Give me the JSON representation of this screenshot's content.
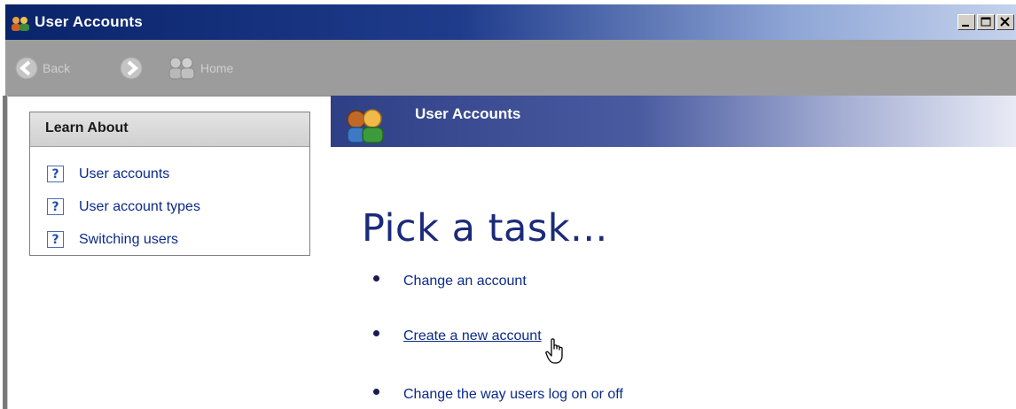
{
  "window": {
    "title": "User Accounts",
    "controls": [
      "minimize",
      "maximize",
      "close"
    ]
  },
  "toolbar": {
    "back_label": "Back",
    "forward_icon": "forward-arrow",
    "home_label": "Home"
  },
  "learn_about": {
    "title": "Learn About",
    "items": [
      {
        "icon": "help-icon",
        "label": "User accounts"
      },
      {
        "icon": "help-icon",
        "label": "User account types"
      },
      {
        "icon": "help-icon",
        "label": "Switching users"
      }
    ]
  },
  "banner": {
    "title": "User Accounts",
    "icon": "users-icon"
  },
  "main": {
    "heading": "Pick a task...",
    "tasks": [
      {
        "label": "Change an account"
      },
      {
        "label": "Create a new account"
      },
      {
        "label": "Change the way users log on or off"
      }
    ]
  },
  "colors": {
    "title_bar": "#0a246a",
    "link": "#0a2a8a",
    "heading": "#1b2a7a",
    "banner": "#2e3f86",
    "toolbar": "#9c9c9c"
  }
}
